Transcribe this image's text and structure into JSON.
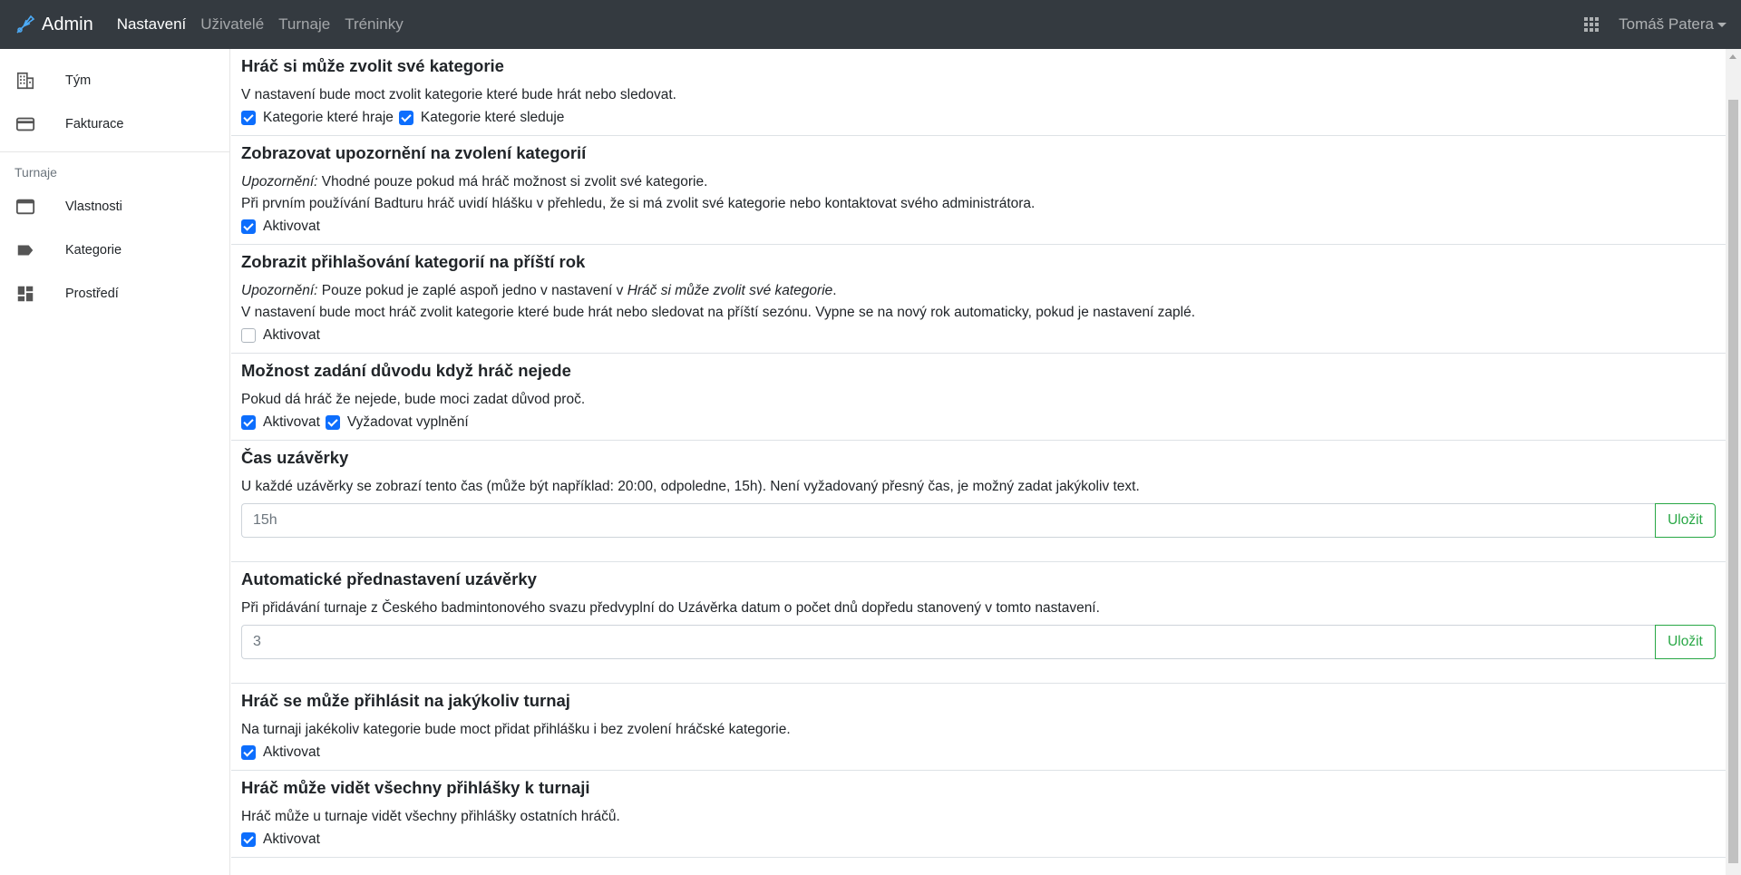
{
  "navbar": {
    "brand": "Admin",
    "links": [
      "Nastavení",
      "Uživatelé",
      "Turnaje",
      "Tréninky"
    ],
    "user": "Tomáš Patera"
  },
  "sidebar": {
    "items_top": [
      {
        "label": "Tým",
        "icon": "building-icon"
      },
      {
        "label": "Fakturace",
        "icon": "credit-card-icon"
      }
    ],
    "heading": "Turnaje",
    "items_tournament": [
      {
        "label": "Vlastnosti",
        "icon": "window-icon"
      },
      {
        "label": "Kategorie",
        "icon": "label-icon"
      },
      {
        "label": "Prostředí",
        "icon": "dashboard-icon"
      }
    ]
  },
  "sections": {
    "s1": {
      "title": "Hráč si může zvolit své kategorie",
      "desc": "V nastavení bude moct zvolit kategorie které bude hrát nebo sledovat.",
      "check1": "Kategorie které hraje",
      "check2": "Kategorie které sleduje"
    },
    "s2": {
      "title": "Zobrazovat upozornění na zvolení kategorií",
      "warn": "Upozornění:",
      "desc1": " Vhodné pouze pokud má hráč možnost si zvolit své kategorie.",
      "desc2": "Při prvním používání Badturu hráč uvidí hlášku v přehledu, že si má zvolit své kategorie nebo kontaktovat svého administrátora.",
      "check1": "Aktivovat"
    },
    "s3": {
      "title": "Zobrazit přihlašování kategorií na příští rok",
      "warn": "Upozornění:",
      "desc1a": " Pouze pokud je zaplé aspoň jedno v nastavení v ",
      "desc1b": "Hráč si může zvolit své kategorie",
      "desc1c": ".",
      "desc2": "V nastavení bude moct hráč zvolit kategorie které bude hrát nebo sledovat na příští sezónu. Vypne se na nový rok automaticky, pokud je nastavení zaplé.",
      "check1": "Aktivovat"
    },
    "s4": {
      "title": "Možnost zadání důvodu když hráč nejede",
      "desc": "Pokud dá hráč že nejede, bude moci zadat důvod proč.",
      "check1": "Aktivovat",
      "check2": "Vyžadovat vyplnění"
    },
    "s5": {
      "title": "Čas uzávěrky",
      "desc": "U každé uzávěrky se zobrazí tento čas (může být například: 20:00, odpoledne, 15h). Není vyžadovaný přesný čas, je možný zadat jakýkoliv text.",
      "value": "15h",
      "button": "Uložit"
    },
    "s6": {
      "title": "Automatické přednastavení uzávěrky",
      "desc": "Při přidávání turnaje z Českého badmintonového svazu předvyplní do Uzávěrka datum o počet dnů dopředu stanovený v tomto nastavení.",
      "value": "3",
      "button": "Uložit"
    },
    "s7": {
      "title": "Hráč se může přihlásit na jakýkoliv turnaj",
      "desc": "Na turnaji jakékoliv kategorie bude moct přidat přihlášku i bez zvolení hráčské kategorie.",
      "check1": "Aktivovat"
    },
    "s8": {
      "title": "Hráč může vidět všechny přihlášky k turnaji",
      "desc": "Hráč může u turnaje vidět všechny přihlášky ostatních hráčů.",
      "check1": "Aktivovat"
    }
  },
  "colors": {
    "navbar": "#343a40",
    "checkbox": "#0d6efd",
    "save_button": "#28a745"
  }
}
